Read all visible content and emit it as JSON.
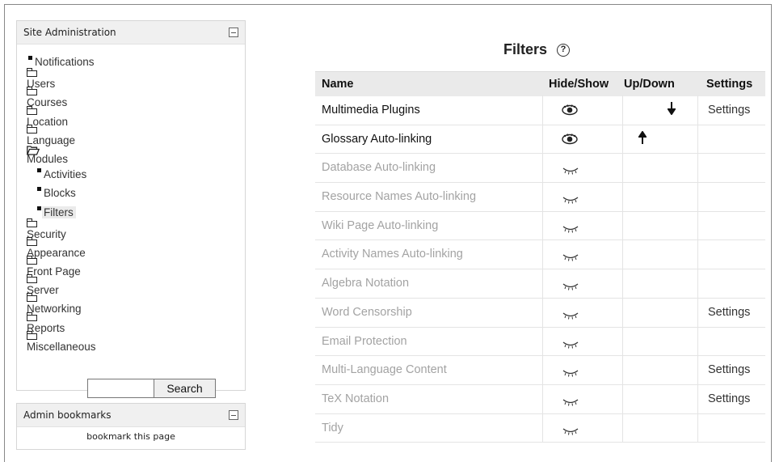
{
  "sidebar": {
    "title": "Site Administration",
    "items": [
      {
        "label": "Notifications",
        "type": "leaf"
      },
      {
        "label": "Users",
        "type": "folder"
      },
      {
        "label": "Courses",
        "type": "folder"
      },
      {
        "label": "Location",
        "type": "folder"
      },
      {
        "label": "Language",
        "type": "folder"
      },
      {
        "label": "Modules",
        "type": "folder-open"
      },
      {
        "label": "Activities",
        "type": "sub"
      },
      {
        "label": "Blocks",
        "type": "sub"
      },
      {
        "label": "Filters",
        "type": "sub-active"
      },
      {
        "label": "Security",
        "type": "folder"
      },
      {
        "label": "Appearance",
        "type": "folder"
      },
      {
        "label": "Front Page",
        "type": "folder"
      },
      {
        "label": "Server",
        "type": "folder"
      },
      {
        "label": "Networking",
        "type": "folder"
      },
      {
        "label": "Reports",
        "type": "folder"
      },
      {
        "label": "Miscellaneous",
        "type": "folder"
      }
    ],
    "search": {
      "value": "",
      "button_label": "Search"
    }
  },
  "bookmarks": {
    "title": "Admin bookmarks",
    "link_label": "bookmark this page"
  },
  "main": {
    "title": "Filters",
    "help_glyph": "?",
    "columns": [
      "Name",
      "Hide/Show",
      "Up/Down",
      "Settings"
    ],
    "rows": [
      {
        "name": "Multimedia Plugins",
        "enabled": true,
        "move": "down",
        "settings": "Settings"
      },
      {
        "name": "Glossary Auto-linking",
        "enabled": true,
        "move": "up",
        "settings": ""
      },
      {
        "name": "Database Auto-linking",
        "enabled": false,
        "move": "",
        "settings": ""
      },
      {
        "name": "Resource Names Auto-linking",
        "enabled": false,
        "move": "",
        "settings": ""
      },
      {
        "name": "Wiki Page Auto-linking",
        "enabled": false,
        "move": "",
        "settings": ""
      },
      {
        "name": "Activity Names Auto-linking",
        "enabled": false,
        "move": "",
        "settings": ""
      },
      {
        "name": "Algebra Notation",
        "enabled": false,
        "move": "",
        "settings": ""
      },
      {
        "name": "Word Censorship",
        "enabled": false,
        "move": "",
        "settings": "Settings"
      },
      {
        "name": "Email Protection",
        "enabled": false,
        "move": "",
        "settings": ""
      },
      {
        "name": "Multi-Language Content",
        "enabled": false,
        "move": "",
        "settings": "Settings"
      },
      {
        "name": "TeX Notation",
        "enabled": false,
        "move": "",
        "settings": "Settings"
      },
      {
        "name": "Tidy",
        "enabled": false,
        "move": "",
        "settings": ""
      }
    ]
  }
}
